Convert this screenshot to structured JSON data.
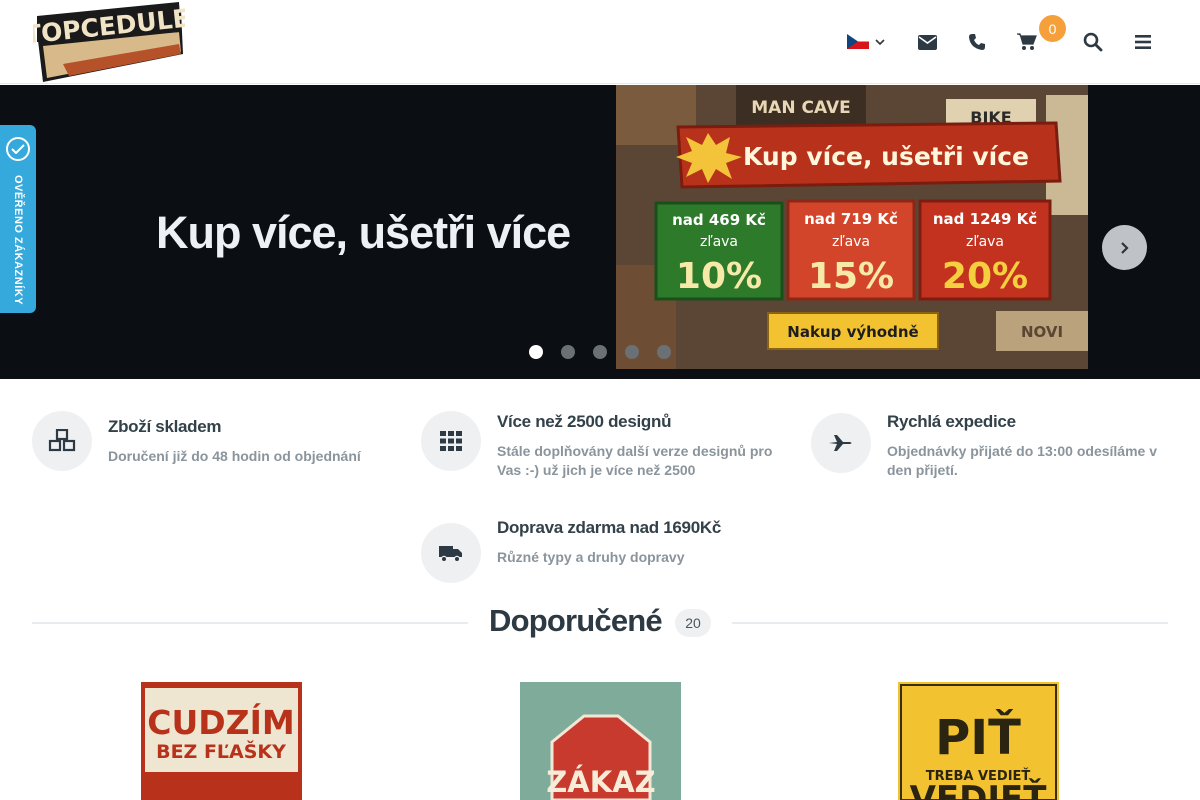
{
  "header": {
    "logo_text": "TOPCEDULE",
    "language": "cs",
    "icons": [
      "envelope-icon",
      "phone-icon",
      "cart-icon",
      "search-icon",
      "menu-icon"
    ],
    "cart_count": "0"
  },
  "hero": {
    "title": "Kup více, ušetři více",
    "banner": {
      "headline": "Kup více, ušetři více",
      "tiers": [
        {
          "threshold": "nad 469 Kč",
          "label": "zľava",
          "discount": "10%"
        },
        {
          "threshold": "nad 719 Kč",
          "label": "zľava",
          "discount": "15%"
        },
        {
          "threshold": "nad 1249 Kč",
          "label": "zľava",
          "discount": "20%"
        }
      ],
      "cta": "Nakup výhodně",
      "bg_signs": [
        "MAN CAVE",
        "BIKE",
        "NOVI"
      ]
    },
    "dots": 5,
    "active_dot": 0
  },
  "verified_badge": {
    "label": "OVĚŘENO ZÁKAZNÍKY",
    "color": "#35a8dc"
  },
  "features": [
    {
      "title": "Zboží skladem",
      "desc": "Doručení již do 48 hodin od objednání",
      "icon": "cubes-icon"
    },
    {
      "title": "Více než 2500 designů",
      "desc": "Stále doplňovány další verze designů pro Vas :-) už jich je více než 2500",
      "icon": "grid-icon"
    },
    {
      "title": "Rychlá expedice",
      "desc": "Objednávky přijaté do 13:00 odesíláme v den přijetí.",
      "icon": "plane-icon"
    },
    {
      "title": "Doprava zdarma nad 1690Kč",
      "desc": "Různé typy a druhy dopravy",
      "icon": "truck-icon"
    }
  ],
  "section": {
    "title": "Doporučené",
    "count": "20"
  },
  "products": [
    {
      "line1": "CUDZÍM",
      "line2": "BEZ FĽAŠKY"
    },
    {
      "line1": "ZÁKAZ"
    },
    {
      "line1": "PIŤ",
      "line2": "TREBA VEDIEŤ",
      "line3": "VEDIEŤ"
    }
  ],
  "colors": {
    "accent": "#f5a03a",
    "hero_bg": "#0b0f14",
    "badge_blue": "#35a8dc"
  }
}
